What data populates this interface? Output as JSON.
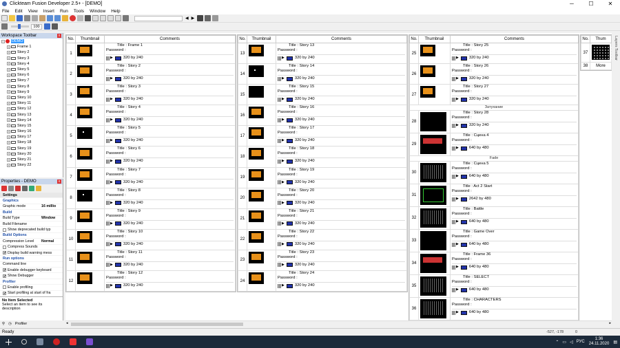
{
  "app": {
    "title": "Clickteam Fusion Developer 2.5+ - [DEMO]",
    "menu": [
      "File",
      "Edit",
      "View",
      "Insert",
      "Run",
      "Tools",
      "Window",
      "Help"
    ],
    "zoom": "100",
    "status": "Ready",
    "coords": "-527, -178",
    "zoom_indicator": "0"
  },
  "workspace": {
    "header": "Workspace Toolbar",
    "root": "DEMO",
    "frames": [
      "Frame 1",
      "Story 2",
      "Story 3",
      "Story 4",
      "Story 5",
      "Story 6",
      "Story 7",
      "Story 8",
      "Story 9",
      "Story 10",
      "Story 11",
      "Story 12",
      "Story 13",
      "Story 14",
      "Story 15",
      "Story 16",
      "Story 17",
      "Story 18",
      "Story 19",
      "Story 20",
      "Story 21",
      "Story 22"
    ]
  },
  "properties": {
    "header": "Properties - DEMO",
    "rows": [
      {
        "kind": "head",
        "label": "Settings"
      },
      {
        "kind": "group",
        "label": "Graphics"
      },
      {
        "kind": "val",
        "label": "Graphic mode",
        "value": "16 millio"
      },
      {
        "kind": "group",
        "label": "Build"
      },
      {
        "kind": "val",
        "label": "Build Type",
        "value": "Window"
      },
      {
        "kind": "val",
        "label": "Build Filename",
        "value": ""
      },
      {
        "kind": "chk",
        "label": "Show deprecated build typ",
        "checked": false
      },
      {
        "kind": "group",
        "label": "Build Options"
      },
      {
        "kind": "val",
        "label": "Compression Level",
        "value": "Normal"
      },
      {
        "kind": "chk",
        "label": "Compress Sounds",
        "checked": false
      },
      {
        "kind": "chk",
        "label": "Display build warning mess",
        "checked": true
      },
      {
        "kind": "group",
        "label": "Run options"
      },
      {
        "kind": "val",
        "label": "Command line",
        "value": ""
      },
      {
        "kind": "chk",
        "label": "Enable debugger keyboard",
        "checked": true
      },
      {
        "kind": "chk",
        "label": "Show Debugger",
        "checked": true
      },
      {
        "kind": "group",
        "label": "Profiler"
      },
      {
        "kind": "chk",
        "label": "Enable profiling",
        "checked": false
      },
      {
        "kind": "chk",
        "label": "Start profiling at start of fra",
        "checked": true
      }
    ],
    "desc_title": "No Item Selected",
    "desc_text": "Select an item to see its description"
  },
  "bottom_tab": "Profiler",
  "storyboard": {
    "headers": {
      "no": "No.",
      "thumb": "Thumbnail",
      "comments": "Comments",
      "thumb_short": "Thum"
    },
    "title_prefix": "Title : ",
    "password_label": "Password :",
    "by": "by",
    "col1": [
      {
        "no": "1",
        "title": "Frame 1",
        "w": "320",
        "h": "240",
        "th": "orange"
      },
      {
        "no": "2",
        "title": "Story 2",
        "w": "320",
        "h": "240",
        "th": "orange"
      },
      {
        "no": "3",
        "title": "Story 3",
        "w": "320",
        "h": "240",
        "th": "orange"
      },
      {
        "no": "4",
        "title": "Story 4",
        "w": "320",
        "h": "240",
        "th": "orange"
      },
      {
        "no": "5",
        "title": "Story 5",
        "w": "320",
        "h": "240",
        "th": "dot"
      },
      {
        "no": "6",
        "title": "Story 6",
        "w": "320",
        "h": "240",
        "th": "orange"
      },
      {
        "no": "7",
        "title": "Story 7",
        "w": "320",
        "h": "240",
        "th": "orange"
      },
      {
        "no": "8",
        "title": "Story 8",
        "w": "320",
        "h": "240",
        "th": "dot"
      },
      {
        "no": "9",
        "title": "Story 9",
        "w": "320",
        "h": "240",
        "th": "orange"
      },
      {
        "no": "10",
        "title": "Story 10",
        "w": "320",
        "h": "240",
        "th": "orange"
      },
      {
        "no": "11",
        "title": "Story 11",
        "w": "320",
        "h": "240",
        "th": "orange"
      },
      {
        "no": "12",
        "title": "Story 12",
        "w": "320",
        "h": "240",
        "th": "orange"
      }
    ],
    "col2": [
      {
        "no": "13",
        "title": "Story 13",
        "w": "320",
        "h": "240",
        "th": "orange"
      },
      {
        "no": "14",
        "title": "Story 14",
        "w": "320",
        "h": "240",
        "th": "dot"
      },
      {
        "no": "15",
        "title": "Story 15",
        "w": "320",
        "h": "240",
        "th": "black"
      },
      {
        "no": "16",
        "title": "Story 16",
        "w": "320",
        "h": "240",
        "th": "orange"
      },
      {
        "no": "17",
        "title": "Story 17",
        "w": "320",
        "h": "240",
        "th": "orange"
      },
      {
        "no": "18",
        "title": "Story 18",
        "w": "320",
        "h": "240",
        "th": "orange"
      },
      {
        "no": "19",
        "title": "Story 19",
        "w": "320",
        "h": "240",
        "th": "orange"
      },
      {
        "no": "20",
        "title": "Story 20",
        "w": "320",
        "h": "240",
        "th": "orange"
      },
      {
        "no": "21",
        "title": "Story 21",
        "w": "320",
        "h": "240",
        "th": "orange"
      },
      {
        "no": "22",
        "title": "Story 22",
        "w": "320",
        "h": "240",
        "th": "orange"
      },
      {
        "no": "23",
        "title": "Story 23",
        "w": "320",
        "h": "240",
        "th": "orange"
      },
      {
        "no": "24",
        "title": "Story 24",
        "w": "320",
        "h": "240",
        "th": "orange"
      }
    ],
    "col3": [
      {
        "no": "25",
        "title": "Story 25",
        "w": "320",
        "h": "240",
        "th": "orange"
      },
      {
        "no": "26",
        "title": "Story 26",
        "w": "320",
        "h": "240",
        "th": "orange"
      },
      {
        "no": "27",
        "title": "Story 27",
        "w": "320",
        "h": "240",
        "th": "orange",
        "sep": "Затухание"
      },
      {
        "no": "28",
        "title": "Story 28",
        "w": "320",
        "h": "240",
        "th": "black"
      },
      {
        "no": "29",
        "title": "Сцена 4",
        "w": "640",
        "h": "480",
        "th": "red",
        "sep": "Fade"
      },
      {
        "no": "30",
        "title": "Сцена 5",
        "w": "640",
        "h": "480",
        "th": "game"
      },
      {
        "no": "31",
        "title": "Act 2 Start",
        "w": "2642",
        "h": "480",
        "th": "green"
      },
      {
        "no": "32",
        "title": "Battle",
        "w": "640",
        "h": "480",
        "th": "game"
      },
      {
        "no": "33",
        "title": "Game Over",
        "w": "640",
        "h": "480",
        "th": "black"
      },
      {
        "no": "34",
        "title": "Frame 36",
        "w": "640",
        "h": "480",
        "th": "red"
      },
      {
        "no": "35",
        "title": "SELECT",
        "w": "640",
        "h": "480",
        "th": "game"
      },
      {
        "no": "36",
        "title": "CHARACTERS",
        "w": "640",
        "h": "480",
        "th": "game"
      }
    ],
    "col4": [
      {
        "no": "37",
        "th": "dots"
      },
      {
        "no": "38",
        "more": "More"
      }
    ]
  },
  "layers_toolbar": "Layers Toolbar",
  "tray": {
    "lang": "РУС",
    "time": "1:36",
    "date": "24.11.2020"
  }
}
